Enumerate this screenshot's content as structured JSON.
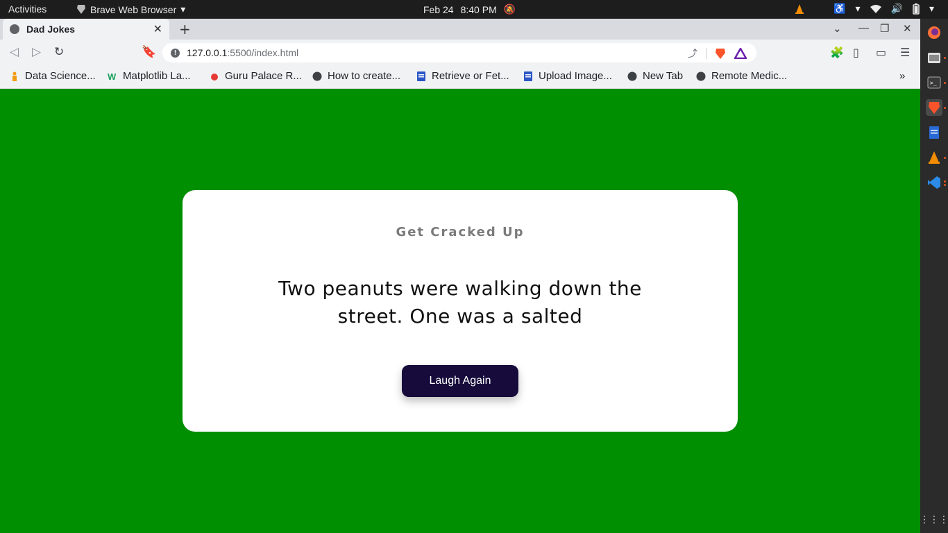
{
  "system": {
    "activities": "Activities",
    "app_name": "Brave Web Browser",
    "date": "Feb 24",
    "time": "8:40 PM"
  },
  "browser": {
    "tab_title": "Dad Jokes",
    "url_host": "127.0.0.1",
    "url_path": ":5500/index.html",
    "bookmarks": [
      {
        "label": "Data Science...",
        "icon": "person-icon"
      },
      {
        "label": "Matplotlib La...",
        "icon": "w-icon"
      },
      {
        "label": "Guru Palace R...",
        "icon": "ladybug-icon"
      },
      {
        "label": "How to create...",
        "icon": "globe-icon"
      },
      {
        "label": "Retrieve or Fet...",
        "icon": "doc-icon"
      },
      {
        "label": "Upload Image...",
        "icon": "doc-icon"
      },
      {
        "label": "New Tab",
        "icon": "globe-icon"
      },
      {
        "label": "Remote Medic...",
        "icon": "globe-icon"
      }
    ]
  },
  "page": {
    "heading": "Get Cracked Up",
    "joke": "Two peanuts were walking down the street. One was a salted",
    "button_label": "Laugh Again"
  },
  "colors": {
    "page_background": "#008f00",
    "button_background": "#160b3a"
  }
}
